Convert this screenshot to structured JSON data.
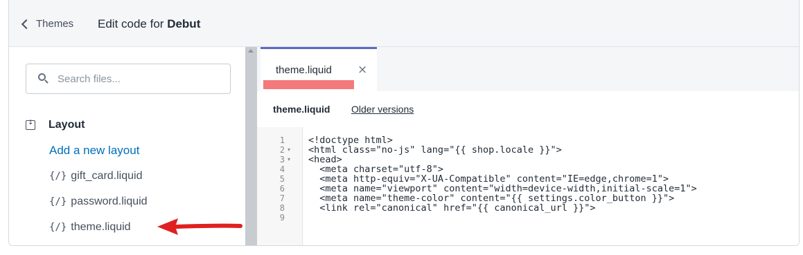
{
  "header": {
    "back_label": "Themes",
    "title_prefix": "Edit code for",
    "theme_name": "Debut"
  },
  "sidebar": {
    "search_placeholder": "Search files...",
    "folder": "Layout",
    "add_link": "Add a new layout",
    "files": [
      "gift_card.liquid",
      "password.liquid",
      "theme.liquid"
    ],
    "file_icon": "{/}"
  },
  "editor": {
    "tab_label": "theme.liquid",
    "tab_close": "×",
    "file_name": "theme.liquid",
    "older_versions": "Older versions",
    "line_numbers": [
      "1",
      "2",
      "3",
      "4",
      "5",
      "6",
      "7",
      "8",
      "9"
    ],
    "lines": [
      "<!doctype html>",
      "<html class=\"no-js\" lang=\"{{ shop.locale }}\">",
      "<head>",
      "  <meta charset=\"utf-8\">",
      "  <meta http-equiv=\"X-UA-Compatible\" content=\"IE=edge,chrome=1\">",
      "  <meta name=\"viewport\" content=\"width=device-width,initial-scale=1\">",
      "  <meta name=\"theme-color\" content=\"{{ settings.color_button }}\">",
      "  <link rel=\"canonical\" href=\"{{ canonical_url }}\">",
      ""
    ]
  },
  "colors": {
    "accent": "#5c6ac4",
    "link": "#006fbb",
    "highlight": "#f3797b",
    "arrow": "#e02020"
  }
}
